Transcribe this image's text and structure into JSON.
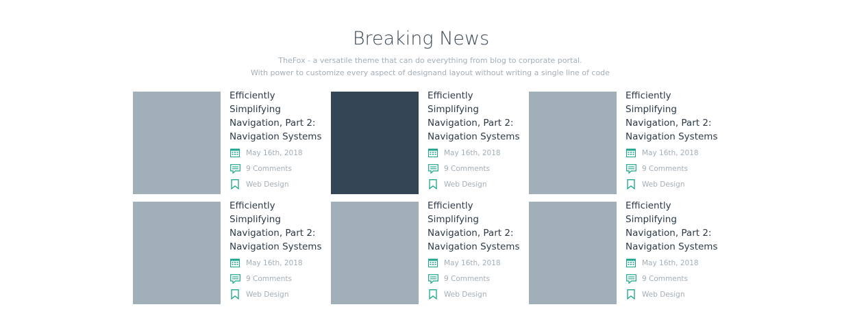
{
  "section": {
    "title": "Breaking News",
    "subtitle_line1": "TheFox - a versatile theme that can do everything from blog to corporate portal.",
    "subtitle_line2": "With power to customize every aspect of designand layout without writing a single line of code"
  },
  "colors": {
    "accent": "#1aa38a",
    "thumb_light": "#a0afb8",
    "thumb_dark": "#344556"
  },
  "posts": [
    {
      "title": "Efficiently\nSimplifying\nNavigation, Part 2:\nNavigation Systems",
      "date": "May 16th, 2018",
      "comments": "9 Comments",
      "category": "Web Design",
      "thumb": "light"
    },
    {
      "title": "Efficiently\nSimplifying\nNavigation, Part 2:\nNavigation Systems",
      "date": "May 16th, 2018",
      "comments": "9 Comments",
      "category": "Web Design",
      "thumb": "dark"
    },
    {
      "title": "Efficiently\nSimplifying\nNavigation, Part 2:\nNavigation Systems",
      "date": "May 16th, 2018",
      "comments": "9 Comments",
      "category": "Web Design",
      "thumb": "light"
    },
    {
      "title": "Efficiently\nSimplifying\nNavigation, Part 2:\nNavigation Systems",
      "date": "May 16th, 2018",
      "comments": "9 Comments",
      "category": "Web Design",
      "thumb": "light"
    },
    {
      "title": "Efficiently\nSimplifying\nNavigation, Part 2:\nNavigation Systems",
      "date": "May 16th, 2018",
      "comments": "9 Comments",
      "category": "Web Design",
      "thumb": "light"
    },
    {
      "title": "Efficiently\nSimplifying\nNavigation, Part 2:\nNavigation Systems",
      "date": "May 16th, 2018",
      "comments": "9 Comments",
      "category": "Web Design",
      "thumb": "light"
    }
  ],
  "icons": {
    "date": "calendar-icon",
    "comments": "comment-icon",
    "category": "bookmark-icon"
  }
}
